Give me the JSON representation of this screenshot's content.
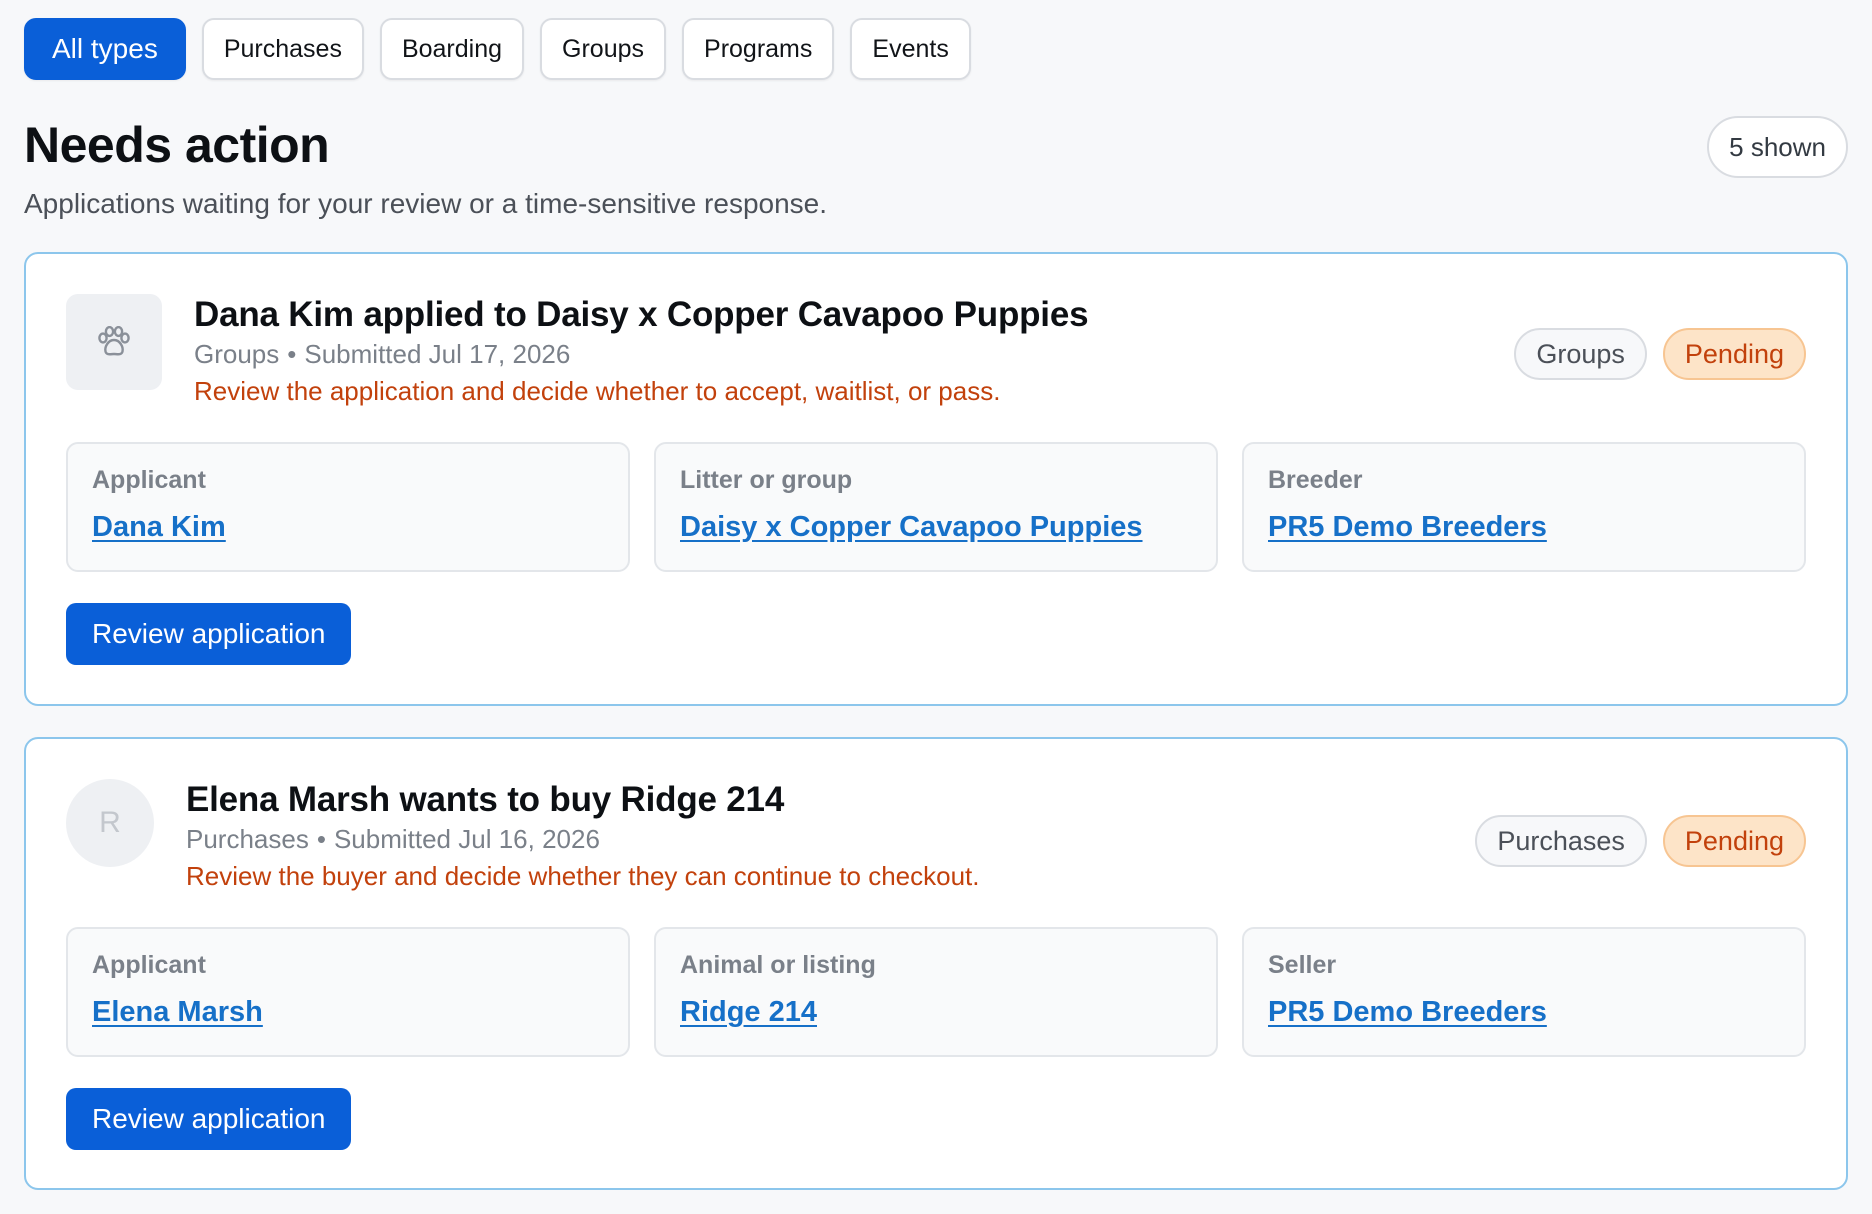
{
  "filters": [
    {
      "label": "All types",
      "active": true
    },
    {
      "label": "Purchases",
      "active": false
    },
    {
      "label": "Boarding",
      "active": false
    },
    {
      "label": "Groups",
      "active": false
    },
    {
      "label": "Programs",
      "active": false
    },
    {
      "label": "Events",
      "active": false
    }
  ],
  "section": {
    "title": "Needs action",
    "subtitle": "Applications waiting for your review or a time-sensitive response.",
    "count_label": "5 shown"
  },
  "colors": {
    "primary": "#0a5fd8",
    "link": "#1670c8",
    "warning_text": "#c2410c",
    "pending_bg": "#fde4c8",
    "card_border": "#8cc6ec"
  },
  "cards": [
    {
      "icon": "paw-icon",
      "title": "Dana Kim applied to Daisy x Copper Cavapoo Puppies",
      "meta_type": "Groups",
      "meta_submitted": "Submitted Jul 17, 2026",
      "description": "Review the application and decide whether to accept, waitlist, or pass.",
      "type_badge": "Groups",
      "status_badge": "Pending",
      "fields": [
        {
          "label": "Applicant",
          "value": "Dana Kim"
        },
        {
          "label": "Litter or group",
          "value": "Daisy x Copper Cavapoo Puppies"
        },
        {
          "label": "Breeder",
          "value": "PR5 Demo Breeders"
        }
      ],
      "action_label": "Review application"
    },
    {
      "avatar_initial": "R",
      "title": "Elena Marsh wants to buy Ridge 214",
      "meta_type": "Purchases",
      "meta_submitted": "Submitted Jul 16, 2026",
      "description": "Review the buyer and decide whether they can continue to checkout.",
      "type_badge": "Purchases",
      "status_badge": "Pending",
      "fields": [
        {
          "label": "Applicant",
          "value": "Elena Marsh"
        },
        {
          "label": "Animal or listing",
          "value": "Ridge 214"
        },
        {
          "label": "Seller",
          "value": "PR5 Demo Breeders"
        }
      ],
      "action_label": "Review application"
    }
  ]
}
